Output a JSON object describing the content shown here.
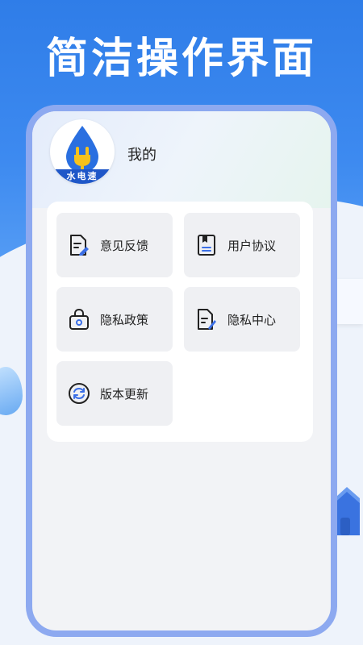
{
  "headline": "简洁操作界面",
  "profile": {
    "title": "我的",
    "logo_text": "水电速"
  },
  "menu": [
    {
      "label": "意见反馈",
      "icon": "document-edit-icon"
    },
    {
      "label": "用户协议",
      "icon": "agreement-book-icon"
    },
    {
      "label": "隐私政策",
      "icon": "lock-bag-icon"
    },
    {
      "label": "隐私中心",
      "icon": "document-pen-icon"
    },
    {
      "label": "版本更新",
      "icon": "refresh-icon"
    }
  ],
  "colors": {
    "brand_blue": "#2f7de8",
    "accent_blue": "#3b6fe6",
    "frame": "#8da9f0"
  }
}
